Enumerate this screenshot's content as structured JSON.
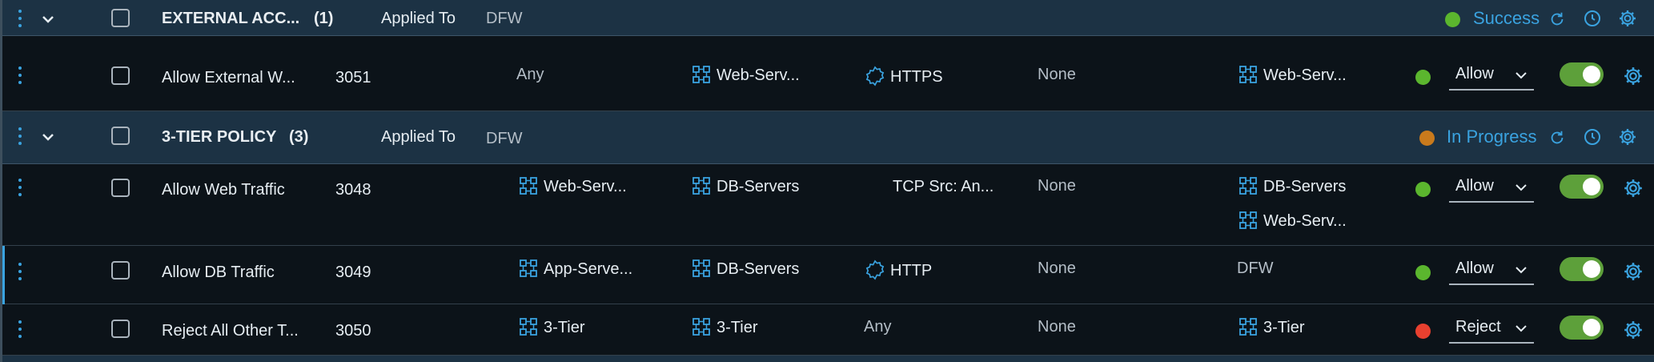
{
  "colors": {
    "accent": "#3aa3e0",
    "section_bg": "#1c3244",
    "row_bg": "#0c1319",
    "status_success": "#5bb62e",
    "status_in_progress": "#c97a1c",
    "action_allow": "#5bb62e",
    "action_reject": "#e8402f",
    "toggle_on": "#5da03a"
  },
  "sections": [
    {
      "name": "EXTERNAL ACC...",
      "count": "(1)",
      "applied_to_label": "Applied To",
      "applied_to": "DFW",
      "status": "Success",
      "status_color": "#5bb62e",
      "icons": [
        "refresh-icon",
        "history-icon",
        "gear-icon"
      ]
    },
    {
      "name": "3-TIER POLICY",
      "count": "(3)",
      "applied_to_label": "Applied To",
      "applied_to": "DFW",
      "status": "In Progress",
      "status_color": "#c97a1c",
      "icons": [
        "refresh-icon",
        "history-icon",
        "gear-icon"
      ]
    }
  ],
  "rules": [
    {
      "name": "Allow External W...",
      "id": "3051",
      "sources": [
        "Any"
      ],
      "destinations": [
        "Web-Serv..."
      ],
      "service": "HTTPS",
      "service_icon": true,
      "profiles": "None",
      "applied_to": [
        "Web-Serv..."
      ],
      "action": "Allow",
      "action_color": "#5bb62e",
      "enabled": true
    },
    {
      "name": "Allow Web Traffic",
      "id": "3048",
      "sources": [
        "Web-Serv..."
      ],
      "destinations": [
        "DB-Servers"
      ],
      "service": "TCP Src: An...",
      "service_icon": false,
      "profiles": "None",
      "applied_to": [
        "DB-Servers",
        "Web-Serv..."
      ],
      "action": "Allow",
      "action_color": "#5bb62e",
      "enabled": true
    },
    {
      "name": "Allow DB Traffic",
      "id": "3049",
      "sources": [
        "App-Serve..."
      ],
      "destinations": [
        "DB-Servers"
      ],
      "service": "HTTP",
      "service_icon": true,
      "profiles": "None",
      "applied_to": [
        "DFW"
      ],
      "action": "Allow",
      "action_color": "#5bb62e",
      "enabled": true
    },
    {
      "name": "Reject All Other T...",
      "id": "3050",
      "sources": [
        "3-Tier"
      ],
      "destinations": [
        "3-Tier"
      ],
      "service": "Any",
      "service_icon": false,
      "profiles": "None",
      "applied_to": [
        "3-Tier"
      ],
      "action": "Reject",
      "action_color": "#e8402f",
      "enabled": true
    }
  ]
}
